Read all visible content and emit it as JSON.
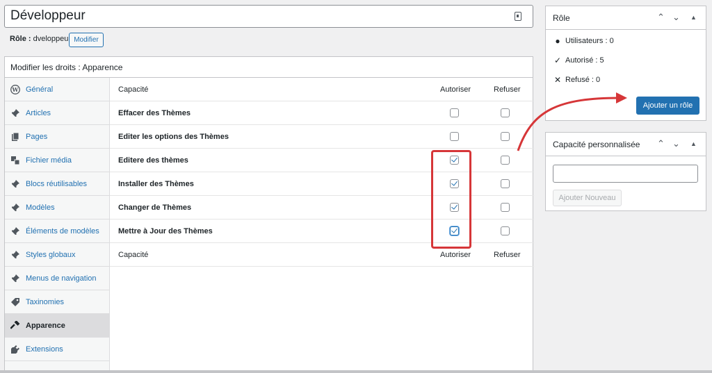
{
  "header": {
    "title": "Développeur",
    "role_label": "Rôle :",
    "role_value": "dveloppeur",
    "modify_button": "Modifier"
  },
  "main_panel": {
    "title": "Modifier les droits : Apparence"
  },
  "sidebar": {
    "items": [
      {
        "label": "Général",
        "icon": "wordpress-icon"
      },
      {
        "label": "Articles",
        "icon": "pin-icon"
      },
      {
        "label": "Pages",
        "icon": "pages-icon"
      },
      {
        "label": "Fichier média",
        "icon": "media-icon"
      },
      {
        "label": "Blocs réutilisables",
        "icon": "pin-icon"
      },
      {
        "label": "Modèles",
        "icon": "pin-icon"
      },
      {
        "label": "Éléments de modèles",
        "icon": "pin-icon"
      },
      {
        "label": "Styles globaux",
        "icon": "pin-icon"
      },
      {
        "label": "Menus de navigation",
        "icon": "pin-icon"
      },
      {
        "label": "Taxinomies",
        "icon": "tag-icon"
      },
      {
        "label": "Apparence",
        "icon": "hammer-icon",
        "active": true
      },
      {
        "label": "Extensions",
        "icon": "plug-icon"
      }
    ]
  },
  "table": {
    "header": {
      "capacity": "Capacité",
      "allow": "Autoriser",
      "deny": "Refuser"
    },
    "rows": [
      {
        "name": "Effacer des Thèmes",
        "allow": false,
        "deny": false
      },
      {
        "name": "Editer les options des Thèmes",
        "allow": false,
        "deny": false
      },
      {
        "name": "Editere des thèmes",
        "allow": true,
        "deny": false
      },
      {
        "name": "Installer des Thèmes",
        "allow": true,
        "deny": false
      },
      {
        "name": "Changer de Thèmes",
        "allow": true,
        "deny": false
      },
      {
        "name": "Mettre à Jour des Thèmes",
        "allow": true,
        "deny": false
      }
    ],
    "footer": {
      "capacity": "Capacité",
      "allow": "Autoriser",
      "deny": "Refuser"
    }
  },
  "role_box": {
    "title": "Rôle",
    "users": "Utilisateurs : 0",
    "allowed": "Autorisé : 5",
    "denied": "Refusé : 0",
    "add_button": "Ajouter un rôle"
  },
  "custom_box": {
    "title": "Capacité personnalisée",
    "input_value": "",
    "add_button": "Ajouter Nouveau"
  },
  "colors": {
    "accent": "#2271b1",
    "highlight": "#d63638"
  }
}
